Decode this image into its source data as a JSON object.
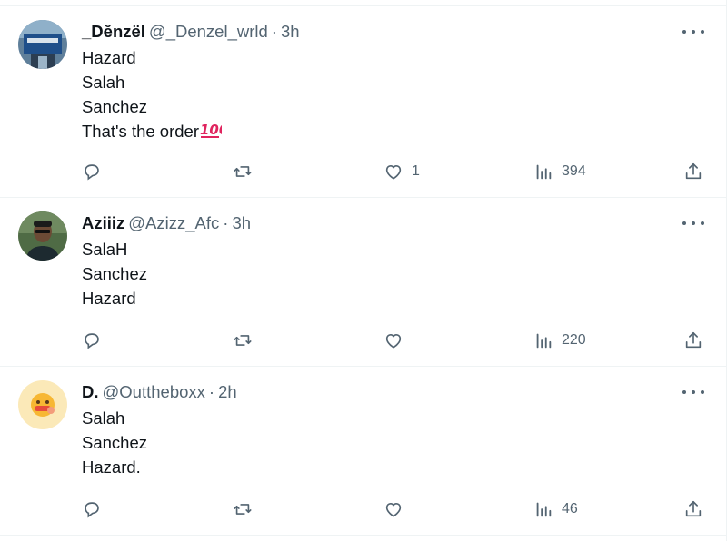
{
  "tweets": [
    {
      "name": "_Dĕnzël",
      "handle": "@_Denzel_wrld",
      "separator": "·",
      "time": "3h",
      "lines": [
        "Hazard",
        "Salah",
        "Sanchez",
        "That's the order"
      ],
      "emoji": "hundred-points-emoji",
      "replies": "",
      "retweets": "",
      "likes": "1",
      "views": "394"
    },
    {
      "name": "Aziiiz",
      "handle": "@Azizz_Afc",
      "separator": "·",
      "time": "3h",
      "lines": [
        "SalaH",
        "Sanchez",
        "Hazard"
      ],
      "replies": "",
      "retweets": "",
      "likes": "",
      "views": "220"
    },
    {
      "name": "D.",
      "handle": "@Outtheboxx",
      "separator": "·",
      "time": "2h",
      "lines": [
        "Salah",
        "Sanchez",
        "Hazard."
      ],
      "replies": "",
      "retweets": "",
      "likes": "",
      "views": "46"
    }
  ],
  "colors": {
    "text_primary": "#0f1419",
    "text_secondary": "#536471",
    "divider": "#eff3f4"
  },
  "icons": [
    "reply-icon",
    "retweet-icon",
    "like-icon",
    "views-icon",
    "share-icon",
    "more-icon"
  ]
}
